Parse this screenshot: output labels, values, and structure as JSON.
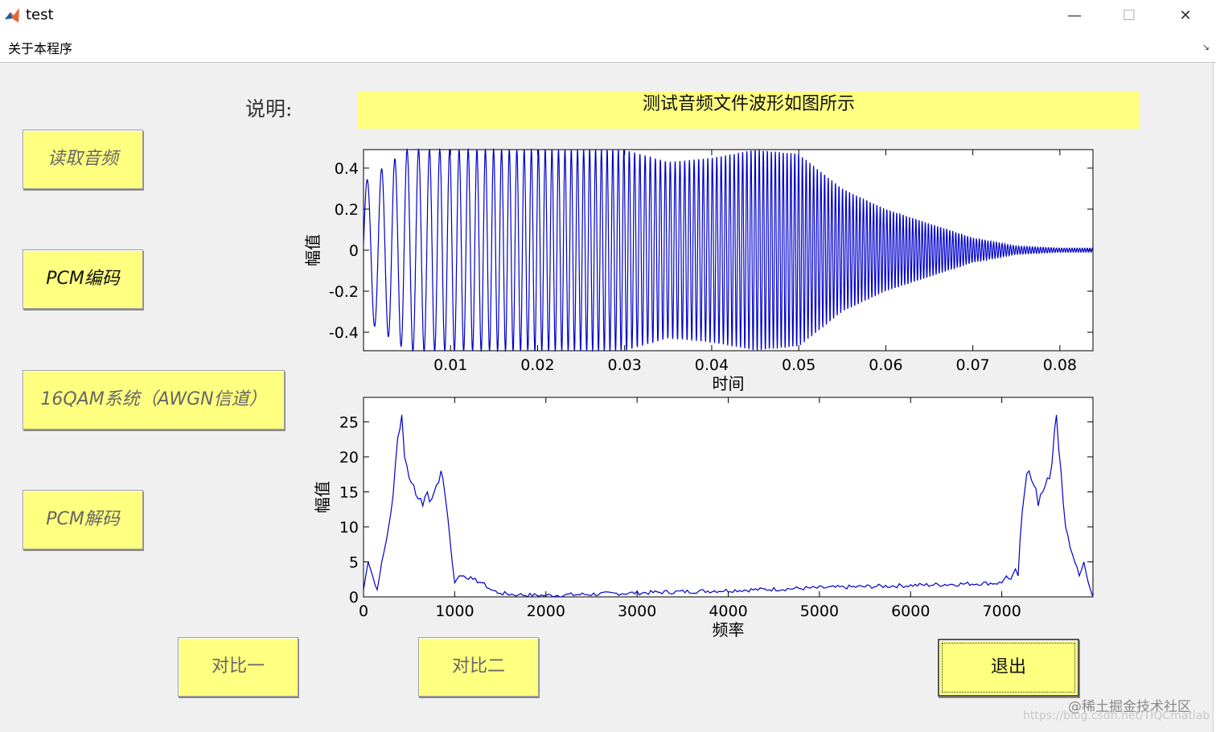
{
  "window": {
    "title": "test",
    "minimize": "—",
    "maximize": "☐",
    "close": "✕"
  },
  "menu": {
    "items": [
      "关于本程序"
    ],
    "corner_arrow": "↘"
  },
  "description": {
    "label": "说明:",
    "text": "测试音频文件波形如图所示",
    "box_color": "#ffff80"
  },
  "buttons": {
    "read_audio": "读取音频",
    "pcm_encode": "PCM编码",
    "qam_system": "16QAM系统（AWGN信道）",
    "pcm_decode": "PCM解码",
    "compare_one": "对比一",
    "compare_two": "对比二",
    "exit": "退出"
  },
  "chart_data": [
    {
      "type": "line",
      "xlabel": "时间",
      "ylabel": "幅值",
      "xticks": [
        0.01,
        0.02,
        0.03,
        0.04,
        0.05,
        0.06,
        0.07,
        0.08
      ],
      "xtick_labels": [
        "0.01",
        "0.02",
        "0.03",
        "0.04",
        "0.05",
        "0.06",
        "0.07",
        "0.08"
      ],
      "yticks": [
        0.4,
        0.2,
        0,
        -0.2,
        -0.4
      ],
      "ytick_labels": [
        "0.4",
        "0.2",
        "0",
        "-0.2",
        "-0.4"
      ],
      "xlim": [
        0,
        0.0838
      ],
      "ylim": [
        -0.49,
        0.49
      ],
      "line_color": "#0000cc",
      "series": [
        {
          "x": [
            0,
            0.005,
            0.01,
            0.015,
            0.02,
            0.025,
            0.03,
            0.035,
            0.04,
            0.045,
            0.05,
            0.055,
            0.06,
            0.065,
            0.07,
            0.075,
            0.08,
            0.0838
          ],
          "values": [
            0.33,
            0.49,
            0.49,
            0.49,
            0.49,
            0.49,
            0.49,
            0.43,
            0.45,
            0.49,
            0.47,
            0.3,
            0.2,
            0.13,
            0.06,
            0.02,
            0.01,
            0.01
          ]
        }
      ]
    },
    {
      "type": "line",
      "xlabel": "频率",
      "ylabel": "幅值",
      "xticks": [
        0,
        1000,
        2000,
        3000,
        4000,
        5000,
        6000,
        7000
      ],
      "xtick_labels": [
        "0",
        "1000",
        "2000",
        "3000",
        "4000",
        "5000",
        "6000",
        "7000"
      ],
      "yticks": [
        0,
        5,
        10,
        15,
        20,
        25
      ],
      "ytick_labels": [
        "0",
        "5",
        "10",
        "15",
        "20",
        "25"
      ],
      "xlim": [
        0,
        8000
      ],
      "ylim": [
        0,
        28.5
      ],
      "line_color": "#0000cc",
      "series": [
        {
          "x": [
            0,
            50,
            100,
            150,
            200,
            250,
            300,
            350,
            400,
            420,
            450,
            500,
            550,
            600,
            650,
            700,
            750,
            800,
            850,
            870,
            900,
            950,
            1000,
            1050,
            1100,
            1200,
            1300,
            1400,
            1500,
            1700,
            2000,
            7000,
            7050,
            7100,
            7150,
            7180,
            7200,
            7250,
            7300,
            7350,
            7400,
            7450,
            7500,
            7550,
            7580,
            7600,
            7650,
            7700,
            7750,
            7800,
            7850,
            7900,
            7950,
            8000
          ],
          "values": [
            1,
            5,
            3,
            1,
            5,
            8,
            12,
            19,
            24,
            26,
            20,
            17,
            16,
            14,
            13,
            15,
            14,
            16,
            18,
            17,
            14,
            8,
            2,
            3,
            3,
            2.5,
            2,
            1,
            0.5,
            0.3,
            0.2,
            2,
            3,
            2.5,
            4,
            3,
            8,
            15,
            18,
            16,
            13,
            15,
            17,
            19,
            24,
            26,
            18,
            10,
            7,
            5,
            3,
            5,
            2,
            0
          ]
        }
      ]
    }
  ],
  "watermark": {
    "line1": "@稀土掘金技术社区",
    "line2": "https://blog.csdn.net/TIQCmatlab"
  }
}
